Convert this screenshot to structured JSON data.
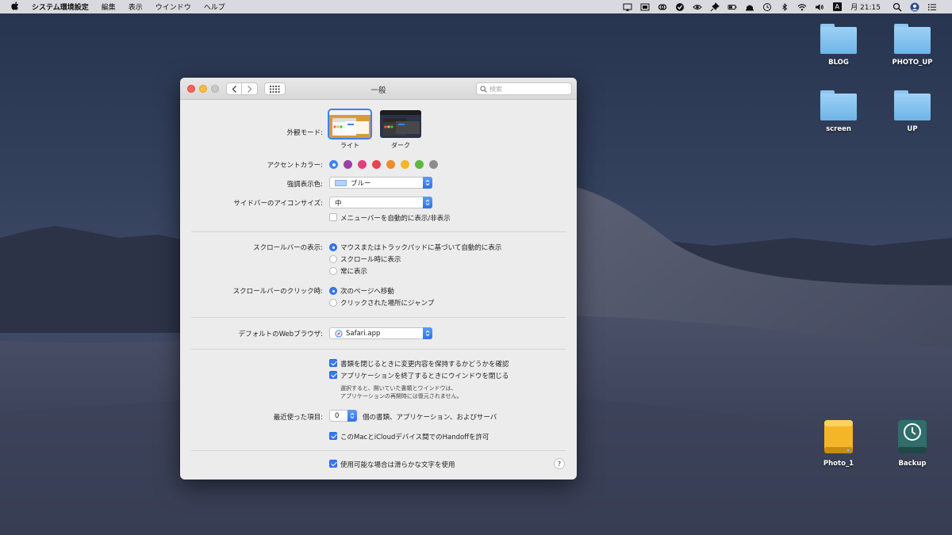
{
  "menubar": {
    "app": "システム環境設定",
    "items": [
      "編集",
      "表示",
      "ウインドウ",
      "ヘルプ"
    ],
    "input_indicator": "A",
    "clock": "月 21:15"
  },
  "desktop": {
    "items": [
      {
        "label": "BLOG",
        "icon": "folder-icon"
      },
      {
        "label": "PHOTO_UP",
        "icon": "folder-icon"
      },
      {
        "label": "screen",
        "icon": "folder-icon"
      },
      {
        "label": "UP",
        "icon": "folder-icon"
      },
      {
        "label": "Photo_1",
        "icon": "external-drive-icon"
      },
      {
        "label": "Backup",
        "icon": "time-machine-drive-icon"
      }
    ]
  },
  "window": {
    "title": "一般",
    "search_placeholder": "検索",
    "appearance": {
      "label": "外観モード:",
      "options": [
        "ライト",
        "ダーク"
      ],
      "selected": "ライト"
    },
    "accent": {
      "label": "アクセントカラー:",
      "colors": [
        "#3b82f6",
        "#9b3fa6",
        "#e23f7e",
        "#e8434b",
        "#f08a2c",
        "#f5b52a",
        "#5cb83f",
        "#8c8c8c"
      ],
      "selected_index": 0
    },
    "highlight": {
      "label": "強調表示色:",
      "value": "ブルー"
    },
    "sidebar_size": {
      "label": "サイドバーのアイコンサイズ:",
      "value": "中"
    },
    "menubar_autohide": {
      "label": "メニューバーを自動的に表示/非表示",
      "checked": false
    },
    "scrollbars": {
      "label": "スクロールバーの表示:",
      "options": [
        "マウスまたはトラックパッドに基づいて自動的に表示",
        "スクロール時に表示",
        "常に表示"
      ],
      "selected_index": 0
    },
    "scroll_click": {
      "label": "スクロールバーのクリック時:",
      "options": [
        "次のページへ移動",
        "クリックされた場所にジャンプ"
      ],
      "selected_index": 0
    },
    "browser": {
      "label": "デフォルトのWebブラウザ:",
      "value": "Safari.app"
    },
    "ask_keep_changes": {
      "label": "書類を閉じるときに変更内容を保持するかどうかを確認",
      "checked": true
    },
    "close_windows": {
      "label": "アプリケーションを終了するときにウインドウを閉じる",
      "checked": true
    },
    "close_windows_note": [
      "選択すると、開いていた書類とウインドウは、",
      "アプリケーションの再開時には復元されません。"
    ],
    "recent_items": {
      "label": "最近使った項目:",
      "value": "0",
      "suffix": "個の書類、アプリケーション、およびサーバ"
    },
    "handoff": {
      "label": "このMacとiCloudデバイス間でのHandoffを許可",
      "checked": true
    },
    "font_smoothing": {
      "label": "使用可能な場合は滑らかな文字を使用",
      "checked": true
    },
    "help": "?"
  }
}
